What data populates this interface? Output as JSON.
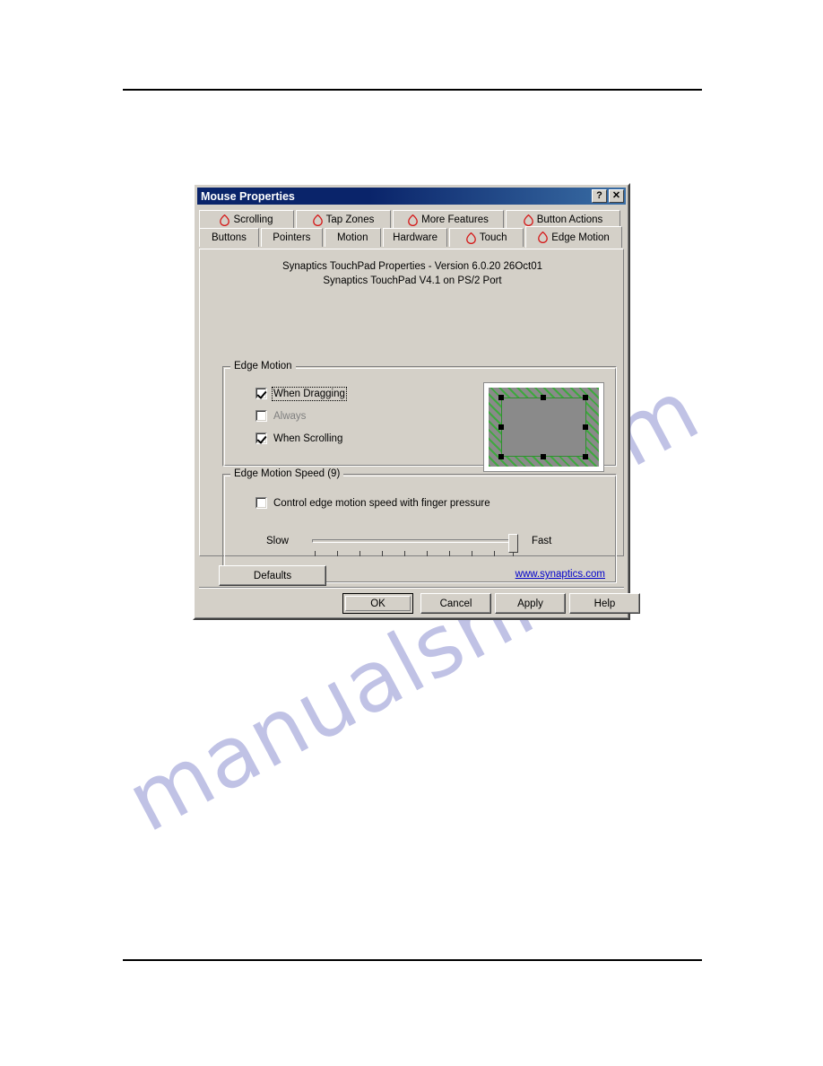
{
  "window": {
    "title": "Mouse Properties",
    "caption_buttons": [
      {
        "name": "help",
        "glyph": "?"
      },
      {
        "name": "close",
        "glyph": "✕"
      }
    ]
  },
  "tabs": {
    "row1": [
      {
        "label": "Scrolling",
        "icon": "synaptics-logo-icon",
        "has_icon": true,
        "active": false
      },
      {
        "label": "Tap Zones",
        "icon": "synaptics-logo-icon",
        "has_icon": true,
        "active": false
      },
      {
        "label": "More Features",
        "icon": "synaptics-logo-icon",
        "has_icon": true,
        "active": false
      },
      {
        "label": "Button Actions",
        "icon": "synaptics-logo-icon",
        "has_icon": true,
        "active": false
      }
    ],
    "row2": [
      {
        "label": "Buttons",
        "has_icon": false,
        "active": false
      },
      {
        "label": "Pointers",
        "has_icon": false,
        "active": false
      },
      {
        "label": "Motion",
        "has_icon": false,
        "active": false
      },
      {
        "label": "Hardware",
        "has_icon": false,
        "active": false
      },
      {
        "label": "Touch",
        "icon": "synaptics-logo-icon",
        "has_icon": true,
        "active": false
      },
      {
        "label": "Edge Motion",
        "icon": "synaptics-logo-icon",
        "has_icon": true,
        "active": true
      }
    ]
  },
  "panel": {
    "version_line1": "Synaptics TouchPad Properties - Version 6.0.20 26Oct01",
    "version_line2": "Synaptics TouchPad V4.1 on PS/2 Port",
    "edge_motion_group": {
      "title": "Edge Motion",
      "checkboxes": [
        {
          "label": "When Dragging",
          "accel": "W",
          "checked": true,
          "focused": true,
          "disabled": false
        },
        {
          "label": "Always",
          "accel": "l",
          "checked": false,
          "focused": false,
          "disabled": true
        },
        {
          "label": "When Scrolling",
          "accel": "S",
          "checked": true,
          "focused": false,
          "disabled": false
        }
      ],
      "preview": {
        "name": "touchpad-edge-preview",
        "handle_count": 8
      }
    },
    "speed_group": {
      "title": "Edge Motion Speed (9)",
      "value": 9,
      "min": 1,
      "max": 10,
      "tick_count": 10,
      "label_slow": "Slow",
      "label_fast": "Fast",
      "pressure_checkbox": {
        "label": "Control edge motion speed with finger pressure",
        "accel": "C",
        "checked": false
      }
    }
  },
  "footer": {
    "defaults_label": "Defaults",
    "link_label": "www.synaptics.com",
    "buttons": {
      "ok": "OK",
      "cancel": "Cancel",
      "apply": "Apply",
      "help": "Help"
    }
  },
  "watermark": {
    "main": "manualshive",
    "tail": ".com"
  },
  "colors": {
    "dialog_face": "#d4d0c8",
    "titlebar_start": "#0a246a",
    "titlebar_end": "#3a6ea5",
    "link": "#0000cc",
    "logo_red": "#d51818",
    "edge_green": "#3fa83f",
    "pad_gray": "#8a8a8a",
    "watermark": "#9a9ed6"
  }
}
